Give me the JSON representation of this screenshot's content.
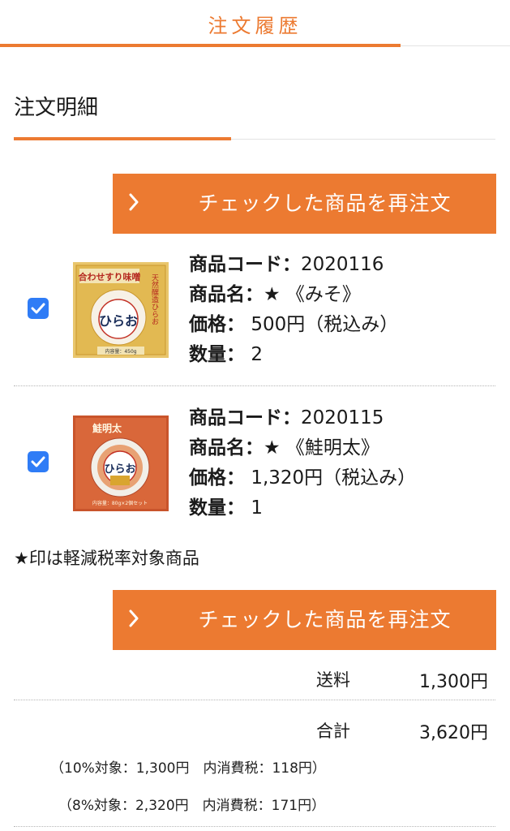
{
  "header": {
    "title": "注文履歴"
  },
  "section": {
    "title": "注文明細"
  },
  "reorder": {
    "label": "チェックした商品を再注文"
  },
  "labels": {
    "code": "商品コード：",
    "name": "商品名：",
    "price": "価格：",
    "quantity": "数量："
  },
  "items": [
    {
      "checked": true,
      "code": "2020116",
      "name": "★ 《みそ》",
      "price": "500円（税込み）",
      "quantity": "2",
      "image": {
        "icon": "miso-product-image",
        "banner_text": "合わせすり味噌",
        "side_text": "天然醸造ひらお",
        "brand_text": "ひらお",
        "content_text": "内容量：450g"
      }
    },
    {
      "checked": true,
      "code": "2020115",
      "name": "★ 《鮭明太》",
      "price": "1,320円（税込み）",
      "quantity": "1",
      "image": {
        "icon": "salmon-mentaiko-product-image",
        "banner_text": "鮭明太",
        "brand_text": "ひらお",
        "content_text": "内容量：80g×2個セット"
      }
    }
  ],
  "note": "★印は軽減税率対象商品",
  "summary": {
    "shipping_label": "送料",
    "shipping_value": "1,300円",
    "total_label": "合計",
    "total_value": "3,620円",
    "tax10": "（10%対象：1,300円　内消費税：118円）",
    "tax8": "（8%対象：2,320円　内消費税：171円）"
  },
  "colors": {
    "accent": "#ec7a31",
    "checkbox": "#2f7cf6"
  }
}
